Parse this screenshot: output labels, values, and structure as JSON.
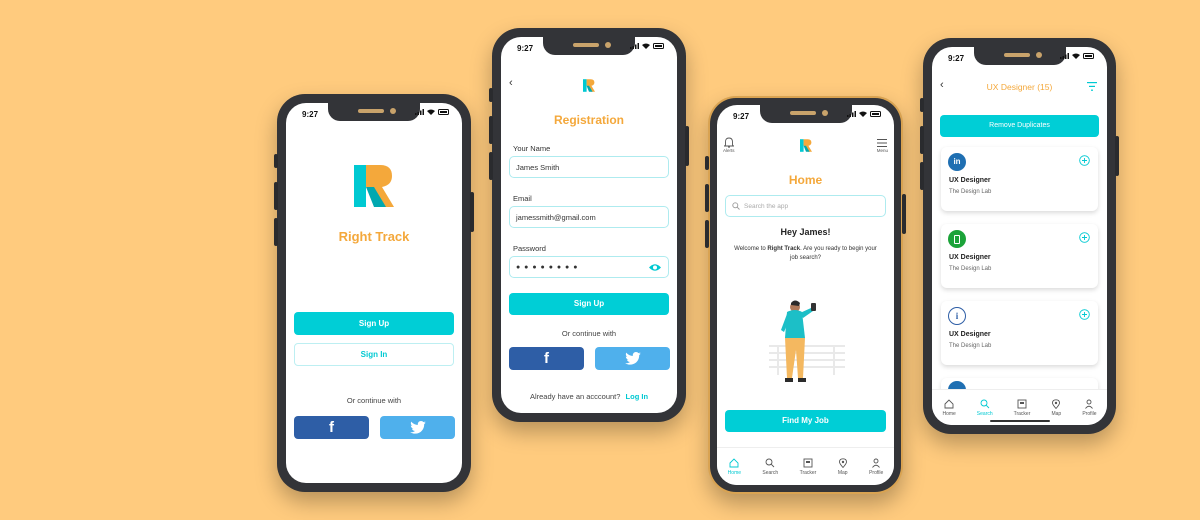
{
  "status": {
    "time": "9:27"
  },
  "splash": {
    "app_name": "Right Track",
    "sign_up": "Sign Up",
    "sign_in": "Sign In",
    "continue_with": "Or continue with"
  },
  "registration": {
    "title": "Registration",
    "name_label": "Your Name",
    "name_value": "James Smith",
    "email_label": "Email",
    "email_value": "jamessmith@gmail.com",
    "password_label": "Password",
    "password_value": "● ● ● ● ● ● ● ●",
    "sign_up": "Sign Up",
    "continue_with": "Or continue with",
    "have_account": "Already have an acccount?",
    "log_in": "Log In"
  },
  "home": {
    "alerts": "Alerts",
    "menu": "Menu",
    "title": "Home",
    "search_placeholder": "Search the app",
    "greeting": "Hey James!",
    "welcome_prefix": "Welcome to ",
    "welcome_brand": "Right Track",
    "welcome_suffix": ". Are you ready to begin your job search?",
    "find_job": "Find My Job"
  },
  "results": {
    "title": "UX Designer (15)",
    "remove_duplicates": "Remove Duplicates",
    "cards": [
      {
        "title": "UX Designer",
        "company": "The Design Lab"
      },
      {
        "title": "UX Designer",
        "company": "The Design Lab"
      },
      {
        "title": "UX Designer",
        "company": "The Design Lab"
      }
    ]
  },
  "nav": [
    "Home",
    "Search",
    "Tracker",
    "Map",
    "Profile"
  ],
  "colors": {
    "background": "#FFCB7E",
    "teal": "#00CED6",
    "orange": "#F4A83B",
    "facebook": "#2E5EA6",
    "twitter": "#4FB0EC",
    "phone": "#333438"
  }
}
